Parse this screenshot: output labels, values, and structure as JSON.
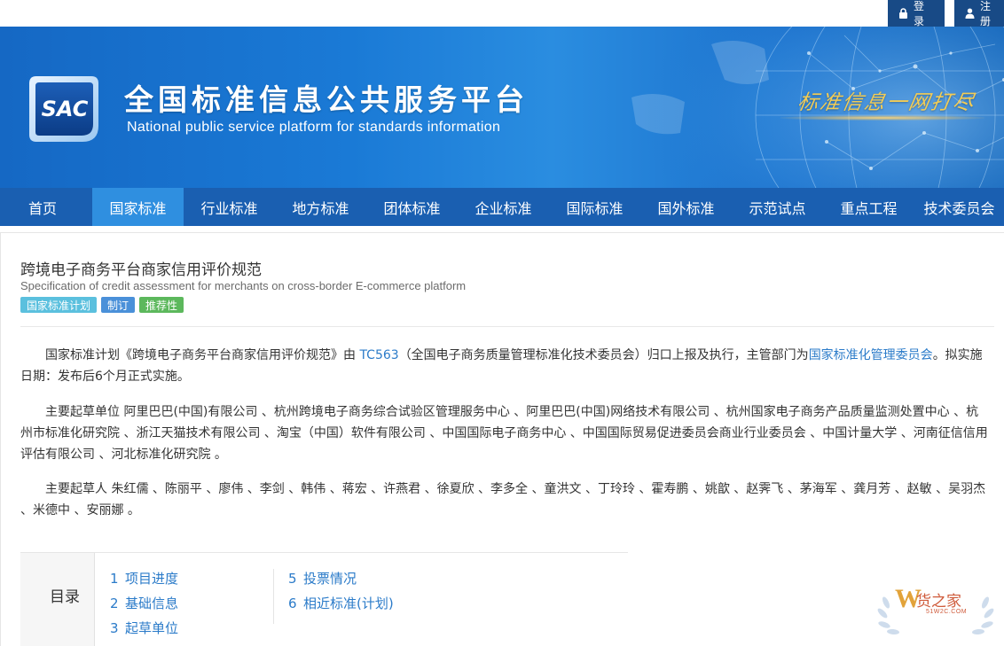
{
  "topbar": {
    "login_label": "登录",
    "register_label": "注册"
  },
  "header": {
    "logo_text": "SAC",
    "title_cn": "全国标准信息公共服务平台",
    "title_en": "National public service platform  for standards information",
    "slogan": "标准信息一网打尽"
  },
  "nav": {
    "items": [
      {
        "label": "首页"
      },
      {
        "label": "国家标准"
      },
      {
        "label": "行业标准"
      },
      {
        "label": "地方标准"
      },
      {
        "label": "团体标准"
      },
      {
        "label": "企业标准"
      },
      {
        "label": "国际标准"
      },
      {
        "label": "国外标准"
      },
      {
        "label": "示范试点"
      },
      {
        "label": "重点工程"
      },
      {
        "label": "技术委员会"
      }
    ],
    "active_index": 1
  },
  "standard": {
    "title": "跨境电子商务平台商家信用评价规范",
    "title_en": "Specification of credit assessment for merchants on cross-border E-commerce platform",
    "tags": [
      {
        "label": "国家标准计划",
        "color": "#5bc0de"
      },
      {
        "label": "制订",
        "color": "#4a90d9"
      },
      {
        "label": "推荐性",
        "color": "#5cb85c"
      }
    ]
  },
  "intro": {
    "part1": "国家标准计划《跨境电子商务平台商家信用评价规范》由 ",
    "tc_link": "TC563",
    "part2": "（全国电子商务质量管理标准化技术委员会）归口上报及执行，主管部门为",
    "dept_link": "国家标准化管理委员会",
    "part3": "。拟实施日期：发布后6个月正式实施。"
  },
  "drafting_units": {
    "label": "主要起草单位",
    "text": "阿里巴巴(中国)有限公司 、杭州跨境电子商务综合试验区管理服务中心 、阿里巴巴(中国)网络技术有限公司 、杭州国家电子商务产品质量监测处置中心 、杭州市标准化研究院 、浙江天猫技术有限公司 、淘宝（中国）软件有限公司 、中国国际电子商务中心 、中国国际贸易促进委员会商业行业委员会 、中国计量大学 、河南征信信用评估有限公司 、河北标准化研究院 。"
  },
  "drafters": {
    "label": "主要起草人",
    "text": "朱红儒 、陈丽平 、廖伟 、李剑 、韩伟 、蒋宏 、许燕君 、徐夏欣 、李多全 、童洪文 、丁玲玲 、霍寿鹏 、姚歆 、赵霁飞 、茅海军 、龚月芳 、赵敏 、吴羽杰 、米德中 、安丽娜 。"
  },
  "toc": {
    "label": "目录",
    "items": [
      {
        "num": "1",
        "label": "项目进度"
      },
      {
        "num": "2",
        "label": "基础信息"
      },
      {
        "num": "3",
        "label": "起草单位"
      },
      {
        "num": "5",
        "label": "投票情况"
      },
      {
        "num": "6",
        "label": "相近标准(计划)"
      }
    ]
  },
  "watermark": {
    "brand": "货之家",
    "site": "51W2C.COM",
    "letter": "W"
  }
}
